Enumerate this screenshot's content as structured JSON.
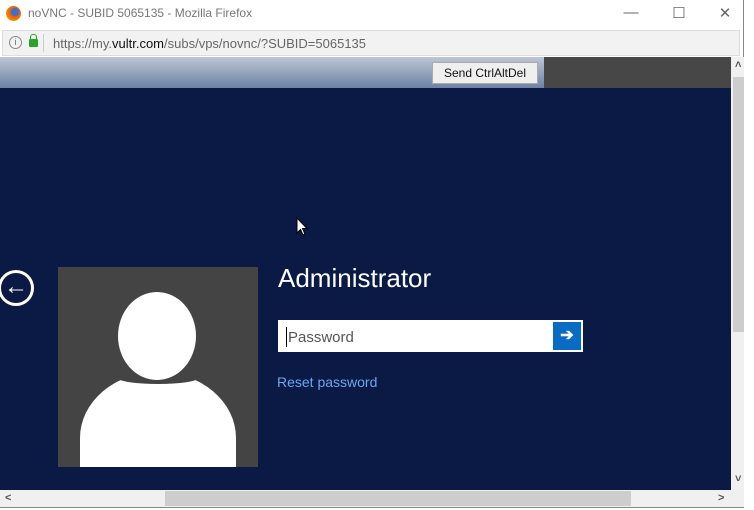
{
  "window": {
    "title": "noVNC - SUBID 5065135 - Mozilla Firefox",
    "minimize": "—",
    "maximize": "☐",
    "close": "✕"
  },
  "urlbar": {
    "prefix": "https://my.",
    "domain": "vultr.com",
    "path": "/subs/vps/novnc/?SUBID=5065135"
  },
  "vnc": {
    "send_cad": "Send CtrlAltDel"
  },
  "login": {
    "username": "Administrator",
    "password_placeholder": "Password",
    "submit": "➔",
    "reset": "Reset password",
    "back": "←"
  },
  "scroll": {
    "up": "˄",
    "down": "˅",
    "left": "<",
    "right": ">"
  }
}
